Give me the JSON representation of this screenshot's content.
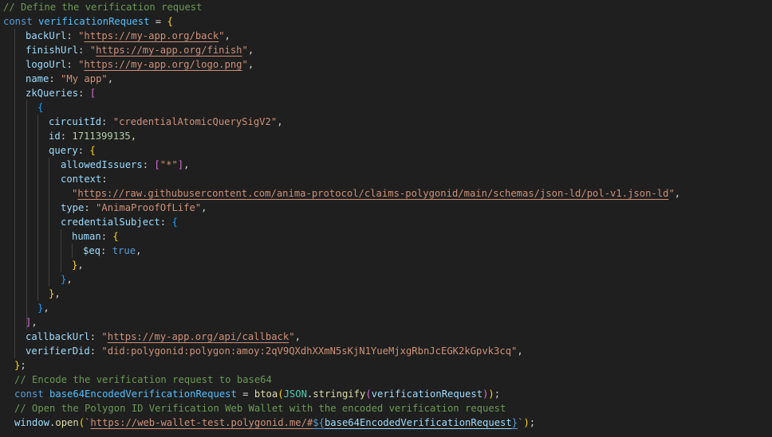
{
  "colors": {
    "background": "#1f1f1f",
    "keyword": "#569cd6",
    "variable": "#4fc1ff",
    "property": "#9cdcfe",
    "string": "#ce9178",
    "number": "#b5cea8",
    "comment": "#6a9955",
    "function": "#dcdcaa",
    "class": "#4ec9b0",
    "bracket_level_1": "#ffd700",
    "bracket_level_2": "#da70d6",
    "bracket_level_3": "#179fff"
  },
  "code": {
    "comment_define": "// Define the verification request",
    "kw_const": "const",
    "var_request": "verificationRequest",
    "key_backUrl": "backUrl",
    "val_backUrl": "https://my-app.org/back",
    "key_finishUrl": "finishUrl",
    "val_finishUrl": "https://my-app.org/finish",
    "key_logoUrl": "logoUrl",
    "val_logoUrl": "https://my-app.org/logo.png",
    "key_name": "name",
    "val_name": "My app",
    "key_zkQueries": "zkQueries",
    "key_circuitId": "circuitId",
    "val_circuitId": "credentialAtomicQuerySigV2",
    "key_id": "id",
    "val_id": "1711399135",
    "key_query": "query",
    "key_allowedIssuers": "allowedIssuers",
    "val_allowedIssuer": "*",
    "key_context": "context",
    "val_context": "https://raw.githubusercontent.com/anima-protocol/claims-polygonid/main/schemas/json-ld/pol-v1.json-ld",
    "key_type": "type",
    "val_type": "AnimaProofOfLife",
    "key_credentialSubject": "credentialSubject",
    "key_human": "human",
    "key_eq": "$eq",
    "val_eq": "true",
    "key_callbackUrl": "callbackUrl",
    "val_callbackUrl": "https://my-app.org/api/callback",
    "key_verifierDid": "verifierDid",
    "val_verifierDid": "did:polygonid:polygon:amoy:2qV9QXdhXXmN5sKjN1YueMjxgRbnJcEGK2kGpvk3cq",
    "comment_encode": "// Encode the verification request to base64",
    "var_encoded": "base64EncodedVerificationRequest",
    "fn_btoa": "btoa",
    "cls_json": "JSON",
    "fn_stringify": "stringify",
    "comment_open": "// Open the Polygon ID Verification Web Wallet with the encoded verification request",
    "obj_window": "window",
    "fn_open": "open",
    "val_wallet_url": "https://web-wallet-test.polygonid.me/#"
  }
}
